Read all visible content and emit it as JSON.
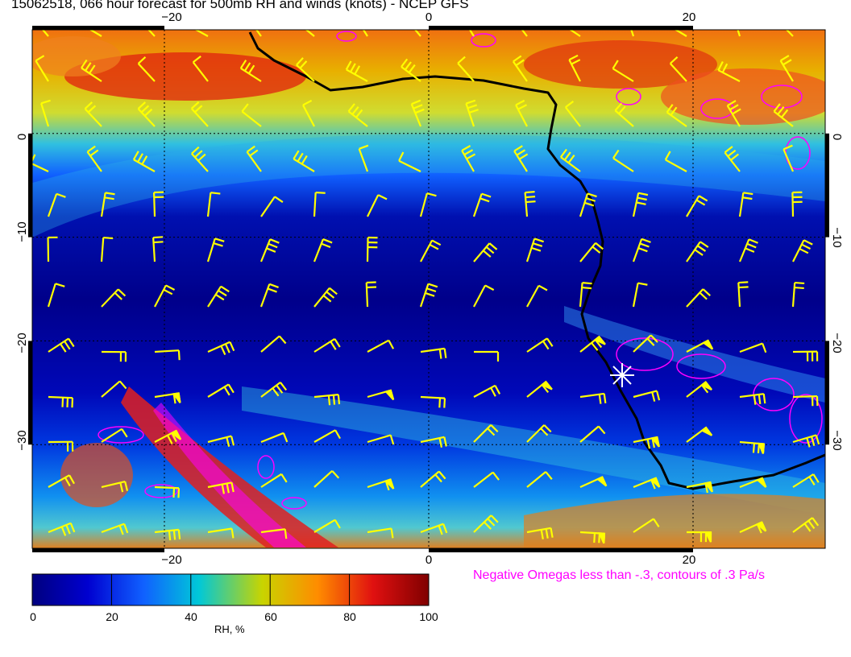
{
  "title": "15062518, 066 hour forecast for 500mb RH and winds (knots) - NCEP GFS",
  "map": {
    "lon_range": [
      -30,
      30
    ],
    "lat_range": [
      -40,
      10
    ],
    "lon_ticks": [
      -20,
      0,
      20
    ],
    "lat_ticks": [
      0,
      -10,
      -20,
      -30
    ],
    "top_lon_labels": [
      "−20",
      "0",
      "20"
    ],
    "bottom_lon_labels": [
      "−20",
      "0",
      "20"
    ],
    "left_lat_labels": [
      "0",
      "−10",
      "−20",
      "−30"
    ],
    "right_lat_labels": [
      "0",
      "−10",
      "−20",
      "−30"
    ],
    "marker": {
      "lon": 15.0,
      "lat": -23.0,
      "symbol": "asterisk",
      "color": "#ffffff"
    },
    "coast_color": "#000000",
    "barb_color": "#ffff00",
    "omega_color": "#ff00ff"
  },
  "colorbar": {
    "ticks": [
      "0",
      "20",
      "40",
      "60",
      "80",
      "100"
    ],
    "label": "RH, %",
    "colors": [
      "#00007f",
      "#0000d0",
      "#1060ff",
      "#00c8d8",
      "#c8d400",
      "#ff8c00",
      "#e01010",
      "#800000"
    ]
  },
  "omega_note": "Negative Omegas less than -.3, contours of .3 Pa/s"
}
